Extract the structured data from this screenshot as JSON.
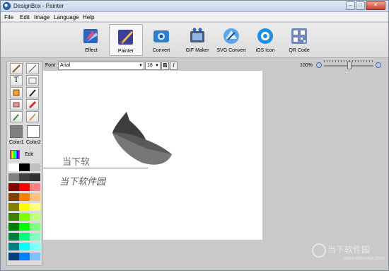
{
  "window": {
    "title": "DesignBox - Painter",
    "buttons": {
      "minimize": "–",
      "maximize": "□",
      "close": "✕"
    }
  },
  "menu": [
    "File",
    "Edit",
    "Image",
    "Language",
    "Help"
  ],
  "toolbar": {
    "tools": [
      {
        "label": "Effect",
        "icon": "effect-icon"
      },
      {
        "label": "Painter",
        "icon": "painter-icon",
        "active": true
      },
      {
        "label": "Convert",
        "icon": "convert-icon"
      },
      {
        "label": "GIF Maker",
        "icon": "gif-maker-icon"
      },
      {
        "label": "SVG Convert",
        "icon": "svg-convert-icon"
      },
      {
        "label": "iOS Icon",
        "icon": "ios-icon-icon"
      },
      {
        "label": "QR Code",
        "icon": "qr-code-icon"
      }
    ]
  },
  "fontbar": {
    "font_label": "Font",
    "font_value": "Arial",
    "size_value": "18",
    "bold_label": "B",
    "italic_label": "I",
    "zoom_value": "100%",
    "zoom_level_percent": 100
  },
  "left_panel": {
    "color1_label": "Color1",
    "color2_label": "Color2",
    "color1": "#808080",
    "color2": "#ffffff",
    "edit_label": "Edit",
    "text_tool_glyph": "T",
    "palette": [
      "#ffffff",
      "#000000",
      "#c0c0c0",
      "#808080",
      "#404040",
      "#303030",
      "#800000",
      "#ff0000",
      "#ff8080",
      "#804000",
      "#ff8000",
      "#ffc080",
      "#808000",
      "#ffff00",
      "#ffff80",
      "#408000",
      "#80ff00",
      "#c0ff80",
      "#008000",
      "#00ff00",
      "#80ff80",
      "#008040",
      "#00ff80",
      "#80ffc0",
      "#008080",
      "#00ffff",
      "#80ffff",
      "#004080",
      "#0080ff",
      "#80c0ff"
    ]
  },
  "canvas": {
    "text_plain": "当下软",
    "text_italic": "当下软件园"
  },
  "watermark": {
    "text": "当下软件园",
    "url": "www.downxia.com"
  }
}
